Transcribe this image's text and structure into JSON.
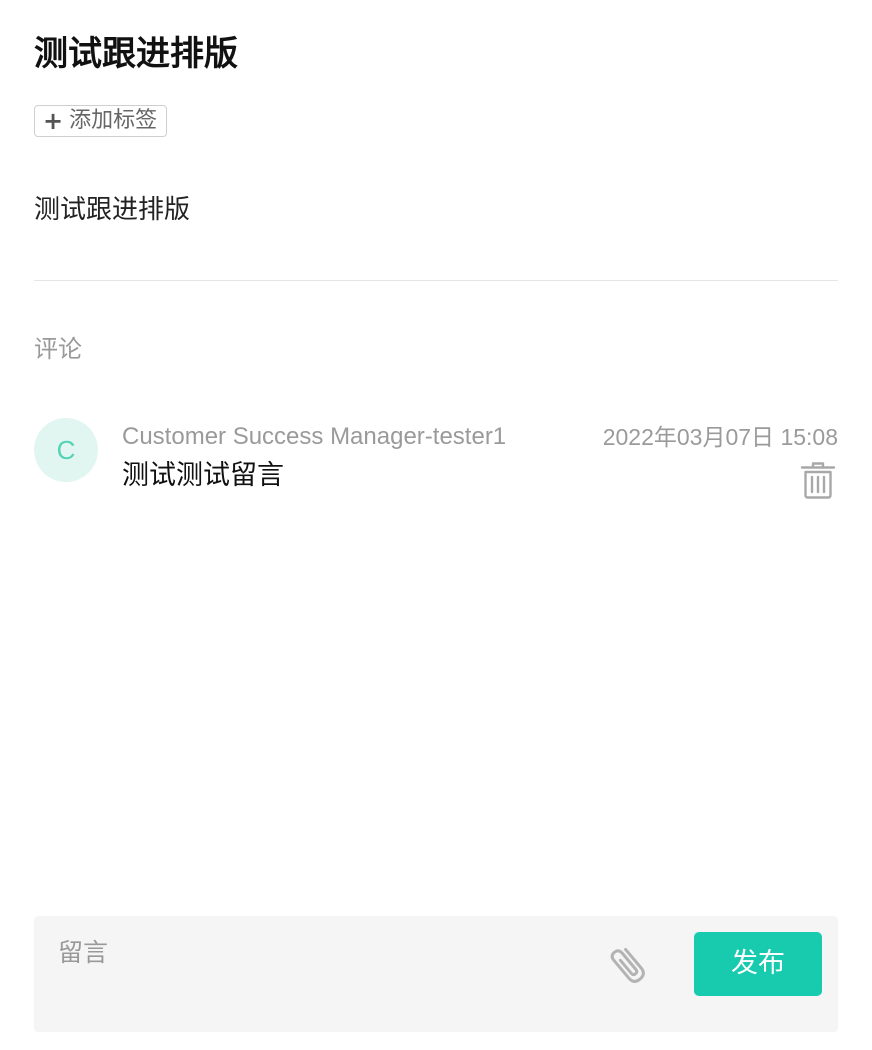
{
  "header": {
    "title": "测试跟进排版",
    "add_tag_plus": "+",
    "add_tag_label": "添加标签"
  },
  "description": "测试跟进排版",
  "comments_section": {
    "label": "评论",
    "comments": [
      {
        "avatar_initial": "C",
        "author": "Customer Success Manager-tester1",
        "timestamp": "2022年03月07日 15:08",
        "text": "测试测试留言",
        "delete_icon": "trash-icon"
      }
    ]
  },
  "composer": {
    "placeholder": "留言",
    "value": "",
    "attach_icon": "paperclip-icon",
    "publish_label": "发布"
  },
  "colors": {
    "accent": "#18cbaf",
    "avatar_bg": "#e1f6f1",
    "avatar_text": "#55d2b6",
    "muted_text": "#9a9a9a",
    "composer_bg": "#f5f5f5"
  }
}
